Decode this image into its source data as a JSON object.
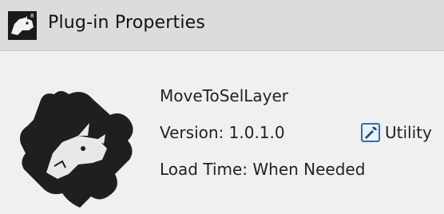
{
  "window": {
    "title": "Plug-in Properties",
    "icon": "rhino-app-icon"
  },
  "plugin": {
    "icon": "rhino-puzzle-piece-icon",
    "name": "MoveToSelLayer",
    "version_text": "Version: 1.0.1.0",
    "load_time_text": "Load Time: When Needed",
    "category": {
      "icon": "utility-tool-icon",
      "label": "Utility"
    }
  }
}
